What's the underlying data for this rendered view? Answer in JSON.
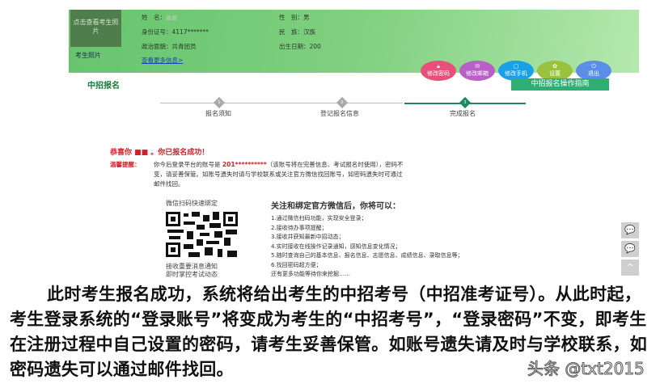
{
  "profile": {
    "photo_button": "点击查看考生照片",
    "photo_label": "考生照片",
    "name_label": "姓　名：",
    "name_value": "■■",
    "id_label": "身份证号：",
    "id_value": "4117*******",
    "politics_label": "政治面貌：",
    "politics_value": "共青团员",
    "gender_label": "性　别：",
    "gender_value": "男",
    "ethnicity_label": "民　族：",
    "ethnicity_value": "汉族",
    "birth_label": "出生日期：",
    "birth_value": "200",
    "more_link": "查看更多信息>"
  },
  "actions": [
    {
      "label": "修改密码",
      "icon": "lock-icon",
      "color": "#e8507a"
    },
    {
      "label": "修改邮箱",
      "icon": "mail-icon",
      "color": "#b85fc8"
    },
    {
      "label": "修改手机",
      "icon": "phone-icon",
      "color": "#1aa0e8"
    },
    {
      "label": "设置",
      "icon": "gear-icon",
      "color": "#9bc23e"
    },
    {
      "label": "退出",
      "icon": "power-icon",
      "color": "#5b8ee8"
    }
  ],
  "guide_button": "中招报名操作指南",
  "section_title": "中招报名",
  "steps": [
    {
      "num": "1",
      "label": "报名须知"
    },
    {
      "num": "2",
      "label": "登记报名信息"
    },
    {
      "num": "3",
      "label": "完成报名"
    }
  ],
  "success": {
    "title": "恭喜你 ■■ 。你已报名成功！",
    "tip_label": "温馨提醒：",
    "tip_text_1": "你今后登录平台的账号是 ",
    "account": "201**********",
    "tip_text_2": "（该账号将在完善信息、考试报名时使用），密码不变，请妥善保管。如账号遗失时请与学校联系或关注官方微信找回账号，如密码遗失时可通过邮件找回。"
  },
  "qr": {
    "title": "微信扫码快速绑定",
    "caption_1": "接收重要消息通知",
    "caption_2": "即时掌控考试动态"
  },
  "wechat": {
    "heading": "关注和绑定官方微信后，你将可以：",
    "items": [
      "1.通过微信扫码功能，实现安全登录；",
      "2.接收待办事项提醒；",
      "3.接收并获知最新中招动态；",
      "4.实时接收在线操作记录通知，感知信息变化情况；",
      "5.随时查询自己的基本信息、报名信息、志愿信息、成绩信息、录取信息等；",
      "6.找回密码超方便；",
      "还有更多功能等待你来挖掘……"
    ]
  },
  "side": [
    "💬",
    "💬",
    "^"
  ],
  "paragraph": "此时考生报名成功，系统将给出考生的中招考号（中招准考证号）。从此时起，考生登录系统的“登录账号”将变成为考生的“中招考号”，“登录密码”不变，即考生在注册过程中自己设置的密码，请考生妥善保管。如账号遗失请及时与学校联系，如密码遗失可以通过邮件找回。",
  "watermark": "头条 @txt2015"
}
